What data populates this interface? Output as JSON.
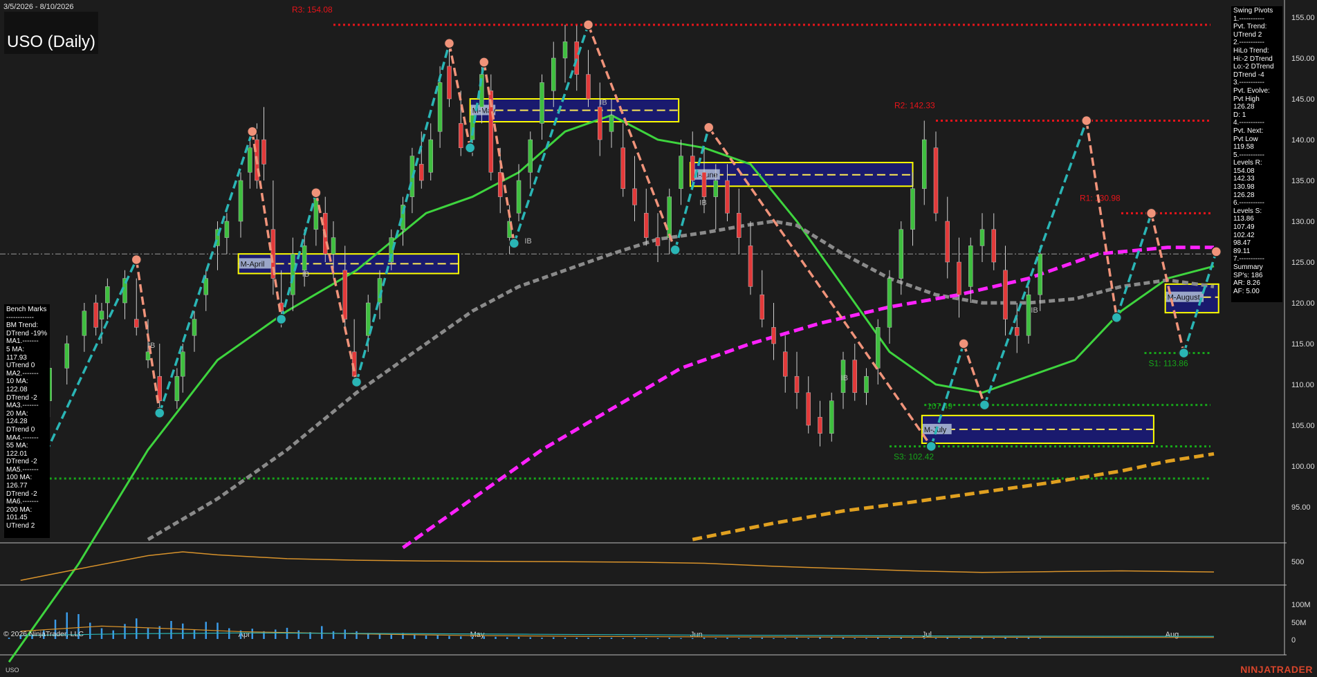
{
  "header": {
    "date_range": "3/5/2026 - 8/10/2026",
    "title": "USO (Daily)"
  },
  "bench_marks": {
    "lines": [
      "Bench Marks",
      "------------",
      "BM Trend:",
      "DTrend -19%",
      "MA1.-------",
      "5 MA:",
      "117.93",
      "UTrend 0",
      "MA2.-------",
      "10 MA:",
      "122.08",
      "DTrend -2",
      "MA3.-------",
      "20 MA:",
      "124.28",
      "DTrend 0",
      "MA4.-------",
      "55 MA:",
      "122.01",
      "DTrend -2",
      "MA5.-------",
      "100 MA:",
      "126.77",
      "DTrend -2",
      "MA6.-------",
      "200 MA:",
      "101.45",
      "UTrend 2"
    ]
  },
  "swing_pivots": {
    "lines": [
      "Swing Pivots",
      "1.-----------",
      "Pvt. Trend:",
      "UTrend 2",
      "2.-----------",
      "HiLo Trend:",
      "Hi:-2 DTrend",
      "Lo:-2 DTrend",
      "DTrend -4",
      "3.-----------",
      "Pvt. Evolve:",
      "Pvt High",
      "126.28",
      "D: 1",
      "4.-----------",
      "Pvt. Next:",
      "Pvt Low",
      "119.58",
      "5.-----------",
      "Levels R:",
      "154.08",
      "142.33",
      "130.98",
      "126.28",
      "6.-----------",
      "Levels S:",
      "113.86",
      "107.49",
      "102.42",
      "98.47",
      "89.11",
      "7.-----------",
      "Summary",
      "SP's: 186",
      "AR: 8.26",
      "AF: 5.00"
    ]
  },
  "footer": {
    "copyright": "© 2026 NinjaTrader, LLC",
    "symbol": "USO",
    "brand": "NINJATRADER"
  },
  "colors": {
    "background": "#1c1c1c",
    "resistance": "#e8141a",
    "support": "#17a51a",
    "swing_up": "#2ab5b5",
    "swing_down": "#f0937a",
    "ma_fast": "#3ed43e",
    "ma_mid": "#8a8a8a",
    "ma_slow": "#ff22ff",
    "ma_long": "#e0a020",
    "volume": "#3a9be8",
    "monthly_box": "#1a1a6e",
    "monthly_border": "#ffff00"
  },
  "chart_data": {
    "type": "candlestick",
    "y_axis_ticks": [
      "155.00",
      "150.00",
      "145.00",
      "140.00",
      "135.00",
      "130.00",
      "125.00",
      "120.00",
      "115.00",
      "110.00",
      "105.00",
      "100.00",
      "95.00"
    ],
    "ylim": [
      90,
      156
    ],
    "x_axis_labels": [
      "Apr",
      "May",
      "Jun",
      "Jul",
      "Aug"
    ],
    "current_price_line": 126.0,
    "resistance_levels": [
      {
        "label": "R3: 154.08",
        "value": 154.08,
        "x_from": 28
      },
      {
        "label": "R2: 142.33",
        "value": 142.33,
        "x_from": 80
      },
      {
        "label": "R1: 130.98",
        "value": 130.98,
        "x_from": 96
      }
    ],
    "support_levels": [
      {
        "label": "S1: 113.86",
        "value": 113.86,
        "x_from": 98
      },
      {
        "label": "",
        "value": 107.49,
        "x_from": 79
      },
      {
        "label": "S3: 102.42",
        "value": 102.42,
        "x_from": 76
      },
      {
        "label": "",
        "value": 98.47,
        "x_from": 1
      }
    ],
    "pivot_labels": [
      {
        "label": "107.49",
        "x": 79,
        "y": 107.0
      }
    ],
    "swing_points": [
      {
        "x": 0,
        "y": 92
      },
      {
        "x": 11,
        "y": 125.3
      },
      {
        "x": 13,
        "y": 106.5
      },
      {
        "x": 21,
        "y": 141
      },
      {
        "x": 23.5,
        "y": 118
      },
      {
        "x": 26.5,
        "y": 133.5
      },
      {
        "x": 30,
        "y": 110.3
      },
      {
        "x": 38,
        "y": 151.8
      },
      {
        "x": 39.8,
        "y": 139
      },
      {
        "x": 41,
        "y": 149.5
      },
      {
        "x": 43.6,
        "y": 127.3
      },
      {
        "x": 50,
        "y": 154.08
      },
      {
        "x": 57.5,
        "y": 126.5
      },
      {
        "x": 60.4,
        "y": 141.5
      },
      {
        "x": 79.6,
        "y": 102.42
      },
      {
        "x": 82.4,
        "y": 115
      },
      {
        "x": 84.2,
        "y": 107.49
      },
      {
        "x": 93,
        "y": 142.33
      },
      {
        "x": 95.6,
        "y": 118.2
      },
      {
        "x": 98.6,
        "y": 130.98
      },
      {
        "x": 101.4,
        "y": 113.86
      },
      {
        "x": 104.2,
        "y": 126.28
      }
    ],
    "monthly_boxes": [
      {
        "label": "M-April",
        "x_from": 19.8,
        "x_to": 38.8,
        "high": 126.0,
        "low": 123.6,
        "mid": 124.8
      },
      {
        "label": "M-May",
        "x_from": 39.8,
        "x_to": 57.8,
        "high": 145.0,
        "low": 142.2,
        "mid": 143.6
      },
      {
        "label": "M-June",
        "x_from": 58.8,
        "x_to": 78,
        "high": 137.2,
        "low": 134.3,
        "mid": 135.7
      },
      {
        "label": "M-July",
        "x_from": 78.8,
        "x_to": 98.8,
        "high": 106.2,
        "low": 102.8,
        "mid": 104.5
      },
      {
        "label": "M-August",
        "x_from": 99.8,
        "x_to": 104.4,
        "high": 122.3,
        "low": 118.8,
        "mid": 120.7
      }
    ],
    "ib_labels": [
      {
        "x": 12,
        "y": 114.5
      },
      {
        "x": 25.3,
        "y": 123.2
      },
      {
        "x": 44.5,
        "y": 127.3
      },
      {
        "x": 51,
        "y": 144.3
      },
      {
        "x": 59.6,
        "y": 132
      },
      {
        "x": 71.8,
        "y": 110.5
      },
      {
        "x": 88.2,
        "y": 118.8
      }
    ],
    "ma_series": [
      {
        "name": "5 MA",
        "color": "#3ed43e",
        "x": [
          0,
          6,
          12,
          18,
          24,
          30,
          36,
          40,
          44,
          48,
          52,
          56,
          60,
          64,
          68,
          72,
          76,
          80,
          84,
          88,
          92,
          96,
          100,
          104
        ],
        "y": [
          76,
          88,
          102,
          113,
          119,
          124,
          131,
          133,
          136,
          141,
          143,
          140,
          139,
          137,
          130,
          122,
          114,
          110,
          109,
          111,
          113,
          119,
          123,
          124.5
        ]
      },
      {
        "name": "55 MA",
        "color": "#8a8a8a",
        "x": [
          12,
          18,
          24,
          30,
          36,
          40,
          44,
          48,
          52,
          56,
          60,
          64,
          66,
          68,
          72,
          76,
          80,
          84,
          88,
          92,
          96,
          100,
          104
        ],
        "y": [
          91,
          96,
          102,
          109,
          115,
          119,
          122,
          124,
          126,
          127.8,
          128.6,
          129.6,
          130,
          129.5,
          126,
          123,
          121,
          120,
          120,
          120.5,
          122,
          122.8,
          122
        ],
        "dashed": true
      },
      {
        "name": "100 MA",
        "color": "#ff22ff",
        "x": [
          34,
          40,
          46,
          52,
          58,
          64,
          70,
          76,
          82,
          88,
          94,
          100,
          104
        ],
        "y": [
          90,
          96,
          102,
          107,
          112,
          115,
          117.5,
          119.5,
          121,
          123,
          126,
          126.8,
          126.8
        ],
        "dashed": true
      },
      {
        "name": "200 MA",
        "color": "#e0a020",
        "x": [
          59,
          66,
          72,
          78,
          84,
          90,
          96,
          100,
          104
        ],
        "y": [
          91,
          93,
          94.5,
          95.6,
          96.8,
          98,
          99.4,
          100.6,
          101.5
        ],
        "dashed": true
      }
    ],
    "candles": [
      [
        1.5,
        101,
        103.5,
        100,
        103
      ],
      [
        2.5,
        103,
        107,
        102,
        106
      ],
      [
        3.5,
        108,
        113,
        106,
        112
      ],
      [
        5,
        112,
        116,
        110,
        115
      ],
      [
        6.5,
        116,
        120,
        114,
        119
      ],
      [
        7.5,
        120,
        121,
        116,
        117
      ],
      [
        8,
        118,
        120,
        115,
        119
      ],
      [
        8.5,
        120,
        123,
        118,
        122
      ],
      [
        10,
        120,
        124,
        118,
        123
      ],
      [
        11,
        118,
        123,
        116,
        117
      ],
      [
        12,
        113,
        118,
        112,
        114
      ],
      [
        13,
        111,
        115,
        107,
        108
      ],
      [
        14.5,
        108,
        112,
        107,
        111
      ],
      [
        15,
        111,
        115,
        109,
        114
      ],
      [
        16,
        116,
        119,
        114,
        118
      ],
      [
        17,
        121,
        124,
        119,
        123
      ],
      [
        18,
        127,
        130,
        124,
        129
      ],
      [
        18.8,
        128,
        131,
        126,
        130
      ],
      [
        20,
        130,
        136,
        128,
        135
      ],
      [
        20.8,
        136,
        140,
        134,
        139
      ],
      [
        21.4,
        140,
        142,
        134,
        135
      ],
      [
        22,
        140,
        144,
        135,
        137
      ],
      [
        22.8,
        129,
        135,
        121,
        123
      ],
      [
        23.5,
        120,
        124,
        117,
        119
      ],
      [
        24.5,
        121,
        128,
        119,
        126
      ],
      [
        25.5,
        124,
        129,
        122,
        127
      ],
      [
        26.5,
        129,
        134,
        127,
        133
      ],
      [
        27.3,
        131,
        133,
        125,
        126
      ],
      [
        28,
        126,
        130,
        123,
        128
      ],
      [
        29,
        124,
        127,
        117,
        118
      ],
      [
        29.8,
        114,
        118,
        110,
        111
      ],
      [
        31,
        116,
        121,
        114,
        120
      ],
      [
        32,
        120,
        124,
        118,
        123
      ],
      [
        33,
        125,
        129,
        124,
        128
      ],
      [
        34,
        129,
        133,
        127,
        132
      ],
      [
        34.8,
        133,
        139,
        131,
        138
      ],
      [
        35.6,
        137,
        141,
        134,
        135
      ],
      [
        36.4,
        136,
        142,
        135,
        140
      ],
      [
        37.2,
        141,
        149,
        139,
        147
      ],
      [
        38,
        149,
        152,
        144,
        145
      ],
      [
        39,
        142,
        146,
        138,
        139
      ],
      [
        40,
        140,
        144,
        138,
        143
      ],
      [
        40.8,
        144,
        149,
        142,
        148
      ],
      [
        41.6,
        146,
        148,
        135,
        136
      ],
      [
        42.4,
        136,
        139,
        131,
        133
      ],
      [
        43.2,
        128,
        132,
        126,
        130
      ],
      [
        44,
        131,
        137,
        130,
        135
      ],
      [
        45,
        136,
        141,
        134,
        140
      ],
      [
        46,
        142,
        148,
        140,
        147
      ],
      [
        47,
        146,
        152,
        144,
        150
      ],
      [
        48,
        150,
        154.08,
        147,
        152
      ],
      [
        49,
        152,
        154,
        146,
        148
      ],
      [
        50,
        148,
        151,
        144,
        145
      ],
      [
        51,
        144,
        147,
        138,
        140
      ],
      [
        52,
        141,
        145,
        139,
        143
      ],
      [
        53,
        139,
        142,
        133,
        134
      ],
      [
        54,
        134,
        138,
        130,
        132
      ],
      [
        55,
        131,
        134,
        127,
        128
      ],
      [
        56,
        128,
        131,
        125,
        127
      ],
      [
        57,
        128,
        134,
        126,
        133
      ],
      [
        58,
        134,
        140,
        132,
        138
      ],
      [
        59,
        138,
        141,
        134,
        135
      ],
      [
        60,
        136,
        139,
        131,
        133
      ],
      [
        61,
        133,
        137,
        129,
        135
      ],
      [
        62,
        135,
        137,
        130,
        131
      ],
      [
        63,
        131,
        134,
        126,
        128
      ],
      [
        64,
        127,
        130,
        121,
        122
      ],
      [
        65,
        121,
        124,
        117,
        118
      ],
      [
        66,
        117,
        120,
        113,
        115
      ],
      [
        67,
        114,
        116,
        109,
        111
      ],
      [
        68,
        111,
        114,
        107,
        109
      ],
      [
        69,
        109,
        111,
        104,
        105
      ],
      [
        70,
        106,
        108,
        102.42,
        104
      ],
      [
        71,
        104,
        109,
        103,
        108
      ],
      [
        72,
        109,
        114,
        107,
        113
      ],
      [
        73,
        113,
        115,
        108,
        109
      ],
      [
        74,
        109,
        112,
        107.49,
        111
      ],
      [
        75,
        112,
        118,
        110,
        117
      ],
      [
        76,
        117,
        124,
        115,
        123
      ],
      [
        77,
        123,
        130,
        121,
        129
      ],
      [
        78,
        129,
        136,
        127,
        134
      ],
      [
        79,
        134,
        142.33,
        132,
        140
      ],
      [
        80,
        139,
        141,
        130,
        131
      ],
      [
        81,
        130,
        133,
        123,
        125
      ],
      [
        82,
        125,
        128,
        118.2,
        121
      ],
      [
        83,
        122,
        128,
        120,
        127
      ],
      [
        84,
        127,
        131,
        125,
        129
      ],
      [
        85,
        129,
        130.98,
        124,
        125
      ],
      [
        86,
        124,
        127,
        116,
        118
      ],
      [
        87,
        117,
        120,
        113.86,
        116
      ],
      [
        88,
        116,
        122,
        115,
        121
      ],
      [
        89,
        121,
        127,
        119,
        126
      ]
    ],
    "oscillator": {
      "x": [
        1,
        6,
        12,
        15,
        18,
        24,
        30,
        36,
        42,
        48,
        54,
        60,
        66,
        72,
        78,
        84,
        90,
        96,
        104
      ],
      "y": [
        0.05,
        0.35,
        0.7,
        0.8,
        0.72,
        0.62,
        0.58,
        0.56,
        0.55,
        0.54,
        0.53,
        0.5,
        0.42,
        0.36,
        0.3,
        0.26,
        0.28,
        0.3,
        0.27
      ],
      "tick": "500"
    },
    "volume": {
      "y_ticks": [
        "100M",
        "50M",
        "0"
      ],
      "bars": [
        3,
        7,
        10,
        20,
        45,
        62,
        58,
        38,
        25,
        20,
        35,
        48,
        25,
        30,
        42,
        36,
        22,
        40,
        38,
        25,
        20,
        24,
        18,
        22,
        26,
        20,
        16,
        30,
        18,
        22,
        18,
        14,
        12,
        10,
        14,
        10,
        8,
        9,
        7,
        6,
        5,
        6,
        5,
        4,
        5,
        4,
        3,
        4,
        3,
        3,
        3,
        2,
        3,
        2,
        3,
        2,
        2,
        3,
        2,
        2,
        3,
        2,
        3,
        2,
        2,
        3,
        2,
        2,
        3,
        2,
        4,
        3,
        3,
        2,
        2,
        3,
        2,
        3,
        2,
        2,
        2,
        3,
        2,
        2,
        3,
        2,
        3,
        2,
        3,
        2
      ]
    }
  }
}
